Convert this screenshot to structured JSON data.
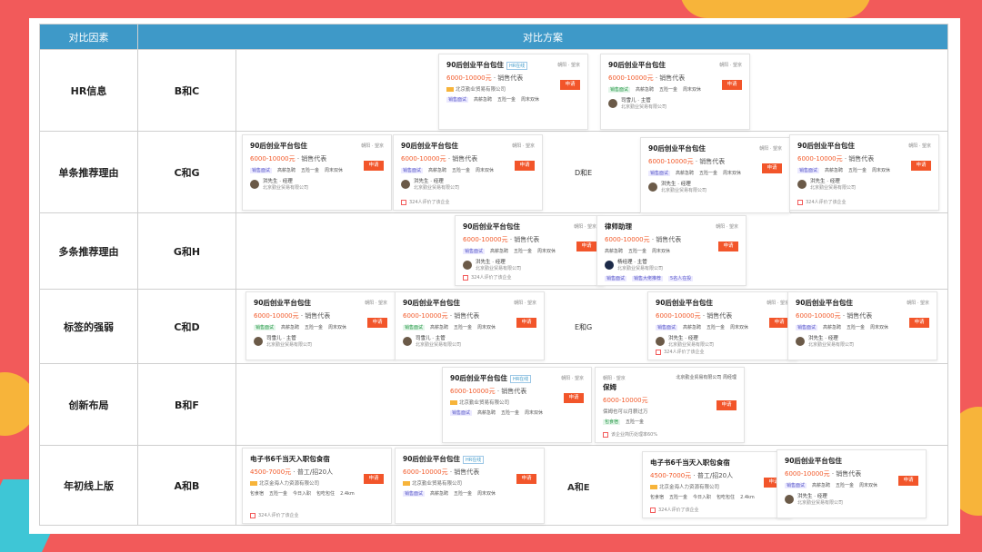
{
  "header": {
    "factor": "对比因素",
    "plan": "对比方案"
  },
  "rows": [
    {
      "factor": "HR信息",
      "combo": "B和C",
      "extra": ""
    },
    {
      "factor": "单条推荐理由",
      "combo": "C和G",
      "extra": "D和E"
    },
    {
      "factor": "多条推荐理由",
      "combo": "G和H",
      "extra": ""
    },
    {
      "factor": "标签的强弱",
      "combo": "C和D",
      "extra": "E和G"
    },
    {
      "factor": "创新布局",
      "combo": "B和F",
      "extra": ""
    },
    {
      "factor": "年初线上版",
      "combo": "A和B",
      "extra": "A和E"
    }
  ],
  "card": {
    "title": "90后创业平台包住",
    "tag": "HR在线",
    "location": "朝阳 · 望京",
    "salary": "6000-10000元",
    "role": "· 销售代表",
    "company": "北京勤业贸易有限公司",
    "tags": [
      "销售面试",
      "高薪急聘",
      "五险一金",
      "周末双休"
    ],
    "hr_name": "洪先生 · 经理",
    "hr_name2": "司雪儿 · 主管",
    "apply": "申请",
    "foot": "324人评价了该企业"
  },
  "card_h": {
    "title": "律师助理",
    "salary": "6000-10000元",
    "tags": [
      "高薪急聘",
      "五险一金",
      "周末双休"
    ],
    "hr_name": "杨经理 · 主管",
    "tags2": [
      "销售面试",
      "销售大佬推荐",
      "5名人在投"
    ]
  },
  "card_f": {
    "title": "保姆",
    "company": "北京勤业贸易有限公司",
    "hr": "周经理",
    "salary": "6000-10000元",
    "desc": "保姆也可以月薪过万",
    "tags": [
      "包食宿",
      "五险一金"
    ],
    "foot": "该企业简历处理率60%"
  },
  "card_a": {
    "title": "电子书6千当天入职包食宿",
    "salary": "4500-7000元",
    "role": "· 普工/招20人",
    "company": "北京金海人力资源有限公司",
    "tags": [
      "包食宿",
      "五险一金",
      "今日入职",
      "包吃包住"
    ],
    "dist": "2.4km",
    "foot": "324人评价了该企业"
  }
}
